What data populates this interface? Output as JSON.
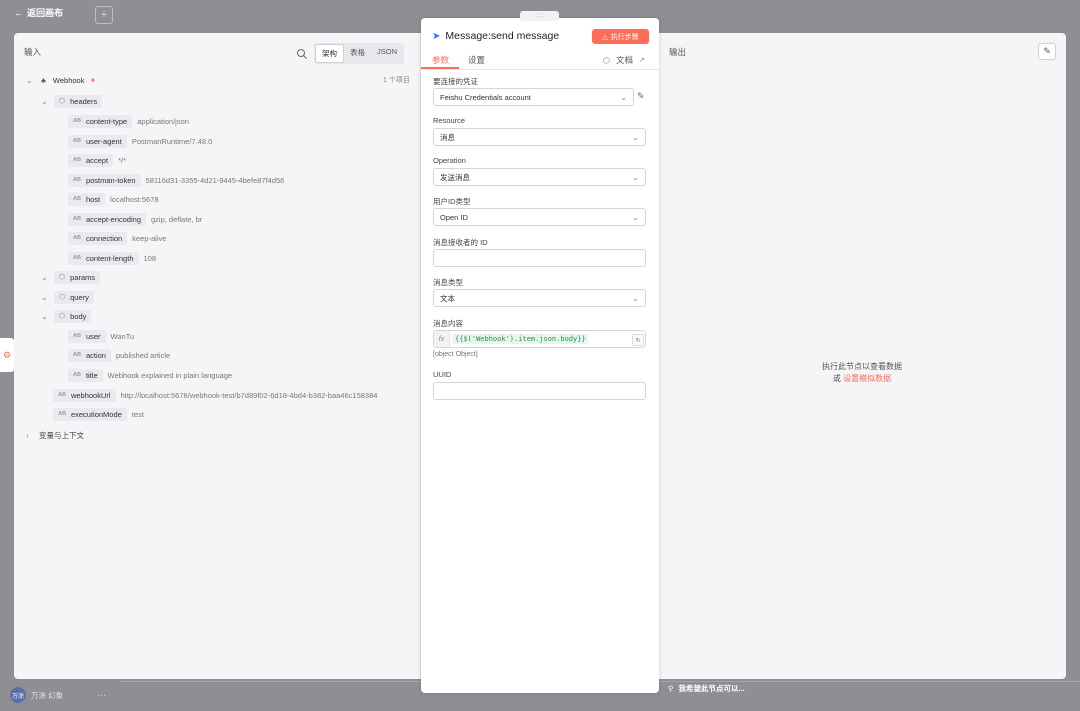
{
  "canvas": {
    "back_label": "返回画布",
    "add_symbol": "+",
    "user_initials": "万涂",
    "user_name": "万涂 幻象",
    "more": "···",
    "hint_text": "我希望此节点可以..."
  },
  "input_panel": {
    "title": "输入",
    "view_modes": [
      "架构",
      "表格",
      "JSON"
    ],
    "item_count": "1 个项目",
    "root": "Webhook",
    "headers_label": "headers",
    "headers": [
      {
        "key": "content-type",
        "value": "application/json"
      },
      {
        "key": "user-agent",
        "value": "PostmanRuntime/7.48.0"
      },
      {
        "key": "accept",
        "value": "*/*"
      },
      {
        "key": "postman-token",
        "value": "58116d31-3355-4d21-9445-4befe87f4d56"
      },
      {
        "key": "host",
        "value": "localhost:5678"
      },
      {
        "key": "accept-encoding",
        "value": "gzip, deflate, br"
      },
      {
        "key": "connection",
        "value": "keep-alive"
      },
      {
        "key": "content-length",
        "value": "108"
      }
    ],
    "params_label": "params",
    "query_label": "query",
    "body_label": "body",
    "body": [
      {
        "key": "user",
        "value": "WanTu"
      },
      {
        "key": "action",
        "value": "published article"
      },
      {
        "key": "title",
        "value": "Webhook explained in plain language"
      }
    ],
    "webhook_url_key": "webhookUrl",
    "webhook_url_value": "http://localhost:5678/webhook-test/b7d89f02-6d18-4bd4-b382-baa46c158384",
    "execution_mode_key": "executionMode",
    "execution_mode_value": "test",
    "variables_label": "变量与上下文",
    "type_tag": "AB"
  },
  "node_panel": {
    "drag_handle": "::::",
    "title": "Message:send message",
    "execute_label": "执行步骤",
    "tabs": [
      "参数",
      "设置"
    ],
    "docs_label": "文档",
    "fields": {
      "credential_label": "要连接的凭证",
      "credential_value": "Feishu Credentials account",
      "resource_label": "Resource",
      "resource_value": "消息",
      "operation_label": "Operation",
      "operation_value": "发送消息",
      "user_id_type_label": "用户ID类型",
      "user_id_type_value": "Open ID",
      "receiver_id_label": "消息接收者的 ID",
      "receiver_id_value": "",
      "message_type_label": "消息类型",
      "message_type_value": "文本",
      "content_label": "消息内容",
      "content_fx": "fx",
      "content_expression": "{{$('Webhook').item.json.body}}",
      "content_result": "[object Object]",
      "uuid_label": "UUID",
      "uuid_value": ""
    }
  },
  "output_panel": {
    "title": "输出",
    "empty_text": "执行此节点以查看数据",
    "or_text": "或",
    "mock_link": "设置模拟数据"
  },
  "colors": {
    "accent": "#ff6d5a",
    "backdrop": "#8e8e93",
    "panel": "#f5f5f7"
  }
}
